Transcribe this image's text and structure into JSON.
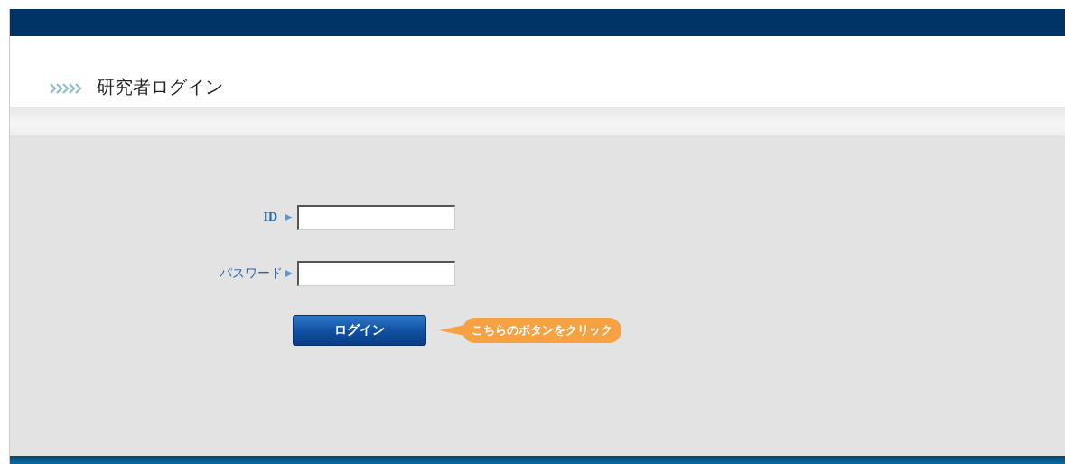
{
  "header": {
    "title": "研究者ログイン"
  },
  "fields": [
    {
      "label": "ID",
      "kind": "text"
    },
    {
      "label": "パスワード",
      "kind": "password"
    }
  ],
  "login_button": "ログイン",
  "callout": "こちらのボタンをクリック"
}
